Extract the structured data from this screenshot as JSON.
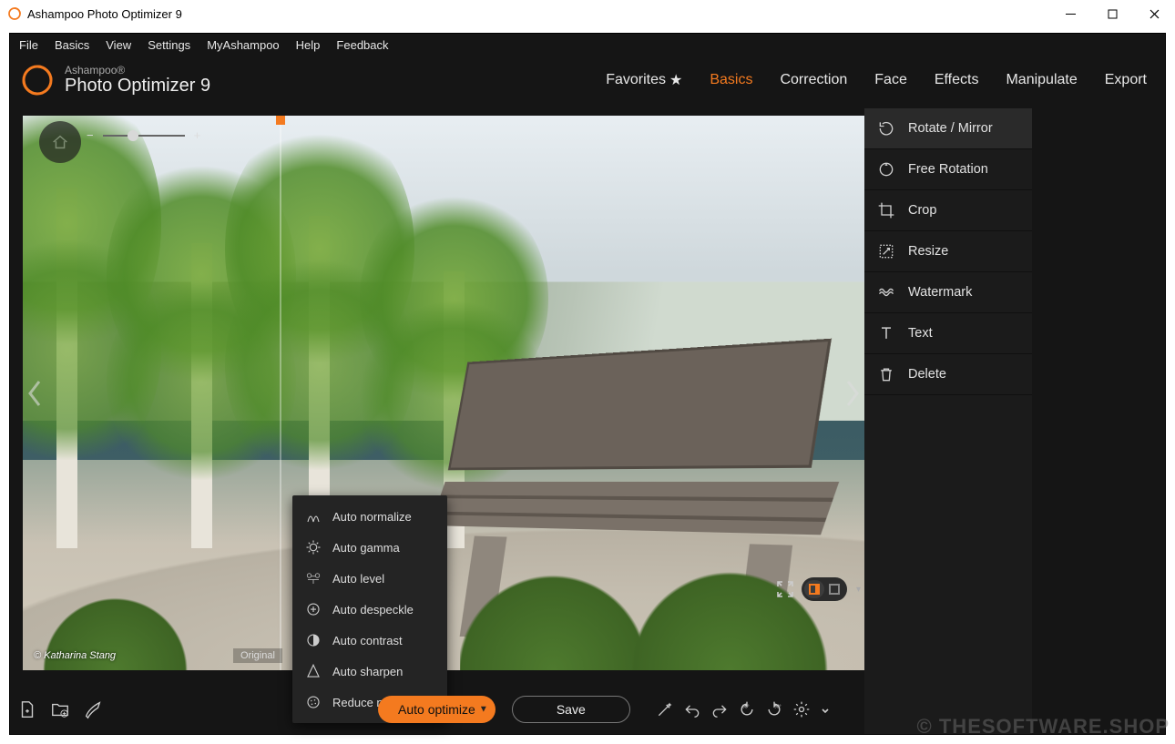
{
  "window": {
    "title": "Ashampoo Photo Optimizer 9"
  },
  "menubar": [
    "File",
    "Basics",
    "View",
    "Settings",
    "MyAshampoo",
    "Help",
    "Feedback"
  ],
  "brand": {
    "line1": "Ashampoo®",
    "line2": "Photo Optimizer 9"
  },
  "tabs": [
    {
      "label": "Favorites",
      "star": true,
      "active": false
    },
    {
      "label": "Basics",
      "active": true
    },
    {
      "label": "Correction",
      "active": false
    },
    {
      "label": "Face",
      "active": false
    },
    {
      "label": "Effects",
      "active": false
    },
    {
      "label": "Manipulate",
      "active": false
    },
    {
      "label": "Export",
      "active": false
    }
  ],
  "side_items": [
    {
      "label": "Rotate / Mirror",
      "icon": "rotate-icon"
    },
    {
      "label": "Free Rotation",
      "icon": "free-rotate-icon"
    },
    {
      "label": "Crop",
      "icon": "crop-icon"
    },
    {
      "label": "Resize",
      "icon": "resize-icon"
    },
    {
      "label": "Watermark",
      "icon": "watermark-icon"
    },
    {
      "label": "Text",
      "icon": "text-icon"
    },
    {
      "label": "Delete",
      "icon": "delete-icon"
    }
  ],
  "auto_menu": [
    {
      "label": "Auto normalize",
      "icon": "normalize-icon"
    },
    {
      "label": "Auto gamma",
      "icon": "gamma-icon"
    },
    {
      "label": "Auto level",
      "icon": "level-icon"
    },
    {
      "label": "Auto despeckle",
      "icon": "despeckle-icon"
    },
    {
      "label": "Auto contrast",
      "icon": "contrast-icon"
    },
    {
      "label": "Auto sharpen",
      "icon": "sharpen-icon"
    },
    {
      "label": "Reduce noise",
      "icon": "noise-icon"
    }
  ],
  "canvas": {
    "original_label": "Original",
    "credit": "© Katharina Stang"
  },
  "buttons": {
    "auto_optimize": "Auto optimize",
    "save": "Save"
  },
  "watermark_text": "© THESOFTWARE.SHOP",
  "colors": {
    "accent": "#f47a1f"
  }
}
